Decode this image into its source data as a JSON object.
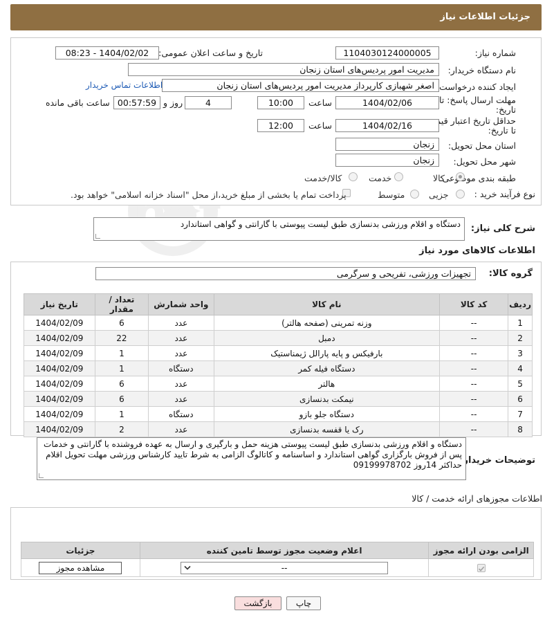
{
  "header": {
    "title": "جزئیات اطلاعات نیاز"
  },
  "form": {
    "need_number_label": "شماره نیاز:",
    "need_number": "1104030124000005",
    "announce_label": "تاریخ و ساعت اعلان عمومی:",
    "announce_value": "1404/02/02 - 08:23",
    "buyer_label": "نام دستگاه خریدار:",
    "buyer_value": "مدیریت امور پردیس‌های استان زنجان",
    "creator_label": "ایجاد کننده درخواست:",
    "creator_value": "اصغر  شهبازی  کارپرداز  مدیریت امور پردیس‌های استان زنجان",
    "contact_link": "اطلاعات تماس خریدار",
    "deadline_label_1": "مهلت ارسال پاسخ: تا",
    "deadline_label_2": "تاریخ:",
    "deadline_date": "1404/02/06",
    "time_label": "ساعت",
    "deadline_time": "10:00",
    "days_value": "4",
    "days_label": "روز و",
    "remaining_value": "00:57:59",
    "remaining_label": "ساعت باقی مانده",
    "validity_label_1": "حداقل تاریخ اعتبار قیمت:",
    "validity_label_2": "تا تاریخ:",
    "validity_date": "1404/02/16",
    "validity_time": "12:00",
    "province_label": "استان محل تحویل:",
    "province_value": "زنجان",
    "city_label": "شهر محل تحویل:",
    "city_value": "زنجان",
    "category_label": "طبقه بندی موضوعی:",
    "category_options": [
      "کالا",
      "خدمت",
      "کالا/خدمت"
    ],
    "category_selected": "کالا",
    "process_label": "نوع فرآیند خرید :",
    "process_options": [
      "جزیی",
      "متوسط"
    ],
    "payment_note": "پرداخت تمام یا بخشی از مبلغ خرید،از محل \"اسناد خزانه اسلامی\" خواهد بود."
  },
  "description": {
    "label": "شرح کلی نیاز:",
    "value": "دستگاه و اقلام ورزشی بدنسازی طبق لیست پیوستی با گارانتی و گواهی استاندارد"
  },
  "goods": {
    "section_title": "اطلاعات کالاهای مورد نیاز",
    "group_label": "گروه کالا:",
    "group_value": "تجهیزات ورزشی، تفریحی و سرگرمی",
    "columns": [
      "ردیف",
      "کد کالا",
      "نام کالا",
      "واحد شمارش",
      "تعداد / مقدار",
      "تاریخ نیاز"
    ],
    "rows": [
      [
        "1",
        "--",
        "وزنه تمرینی (صفحه هالتر)",
        "عدد",
        "6",
        "1404/02/09"
      ],
      [
        "2",
        "--",
        "دمبل",
        "عدد",
        "22",
        "1404/02/09"
      ],
      [
        "3",
        "--",
        "بارفیکس و پایه پارالل ژیمناستیک",
        "عدد",
        "1",
        "1404/02/09"
      ],
      [
        "4",
        "--",
        "دستگاه فیله کمر",
        "دستگاه",
        "1",
        "1404/02/09"
      ],
      [
        "5",
        "--",
        "هالتر",
        "عدد",
        "6",
        "1404/02/09"
      ],
      [
        "6",
        "--",
        "نیمکت بدنسازی",
        "عدد",
        "6",
        "1404/02/09"
      ],
      [
        "7",
        "--",
        "دستگاه جلو بازو",
        "دستگاه",
        "1",
        "1404/02/09"
      ],
      [
        "8",
        "--",
        "رک یا قفسه بدنسازی",
        "عدد",
        "2",
        "1404/02/09"
      ]
    ]
  },
  "buyer_notes": {
    "label": "توضیحات خریدار:",
    "line1": "دستگاه و اقلام ورزشی بدنسازی طبق لیست پیوستی هزینه حمل و بارگیری و ارسال به عهده فروشنده  با گارانتی و خدمات",
    "line2": "پس از فروش بارگزاری گواهی استاندارد و اساسنامه و کاتالوگ الزامی به شرط تایید کارشناس ورزشی مهلت تحویل اقلام",
    "line3": "حداکثر 14روز 09199978702"
  },
  "licenses": {
    "section_title": "اطلاعات مجوزهای ارائه خدمت / کالا",
    "columns": [
      "الزامی بودن ارائه مجوز",
      "اعلام وضعیت مجوز توسط تامین کننده",
      "جزئیات"
    ],
    "select_value": "--",
    "view_button": "مشاهده مجوز"
  },
  "actions": {
    "print": "چاپ",
    "back": "بازگشت"
  },
  "colors": {
    "header_bg": "#8f6f42",
    "link": "#1e5bb5",
    "back_button": "#f9dede"
  }
}
